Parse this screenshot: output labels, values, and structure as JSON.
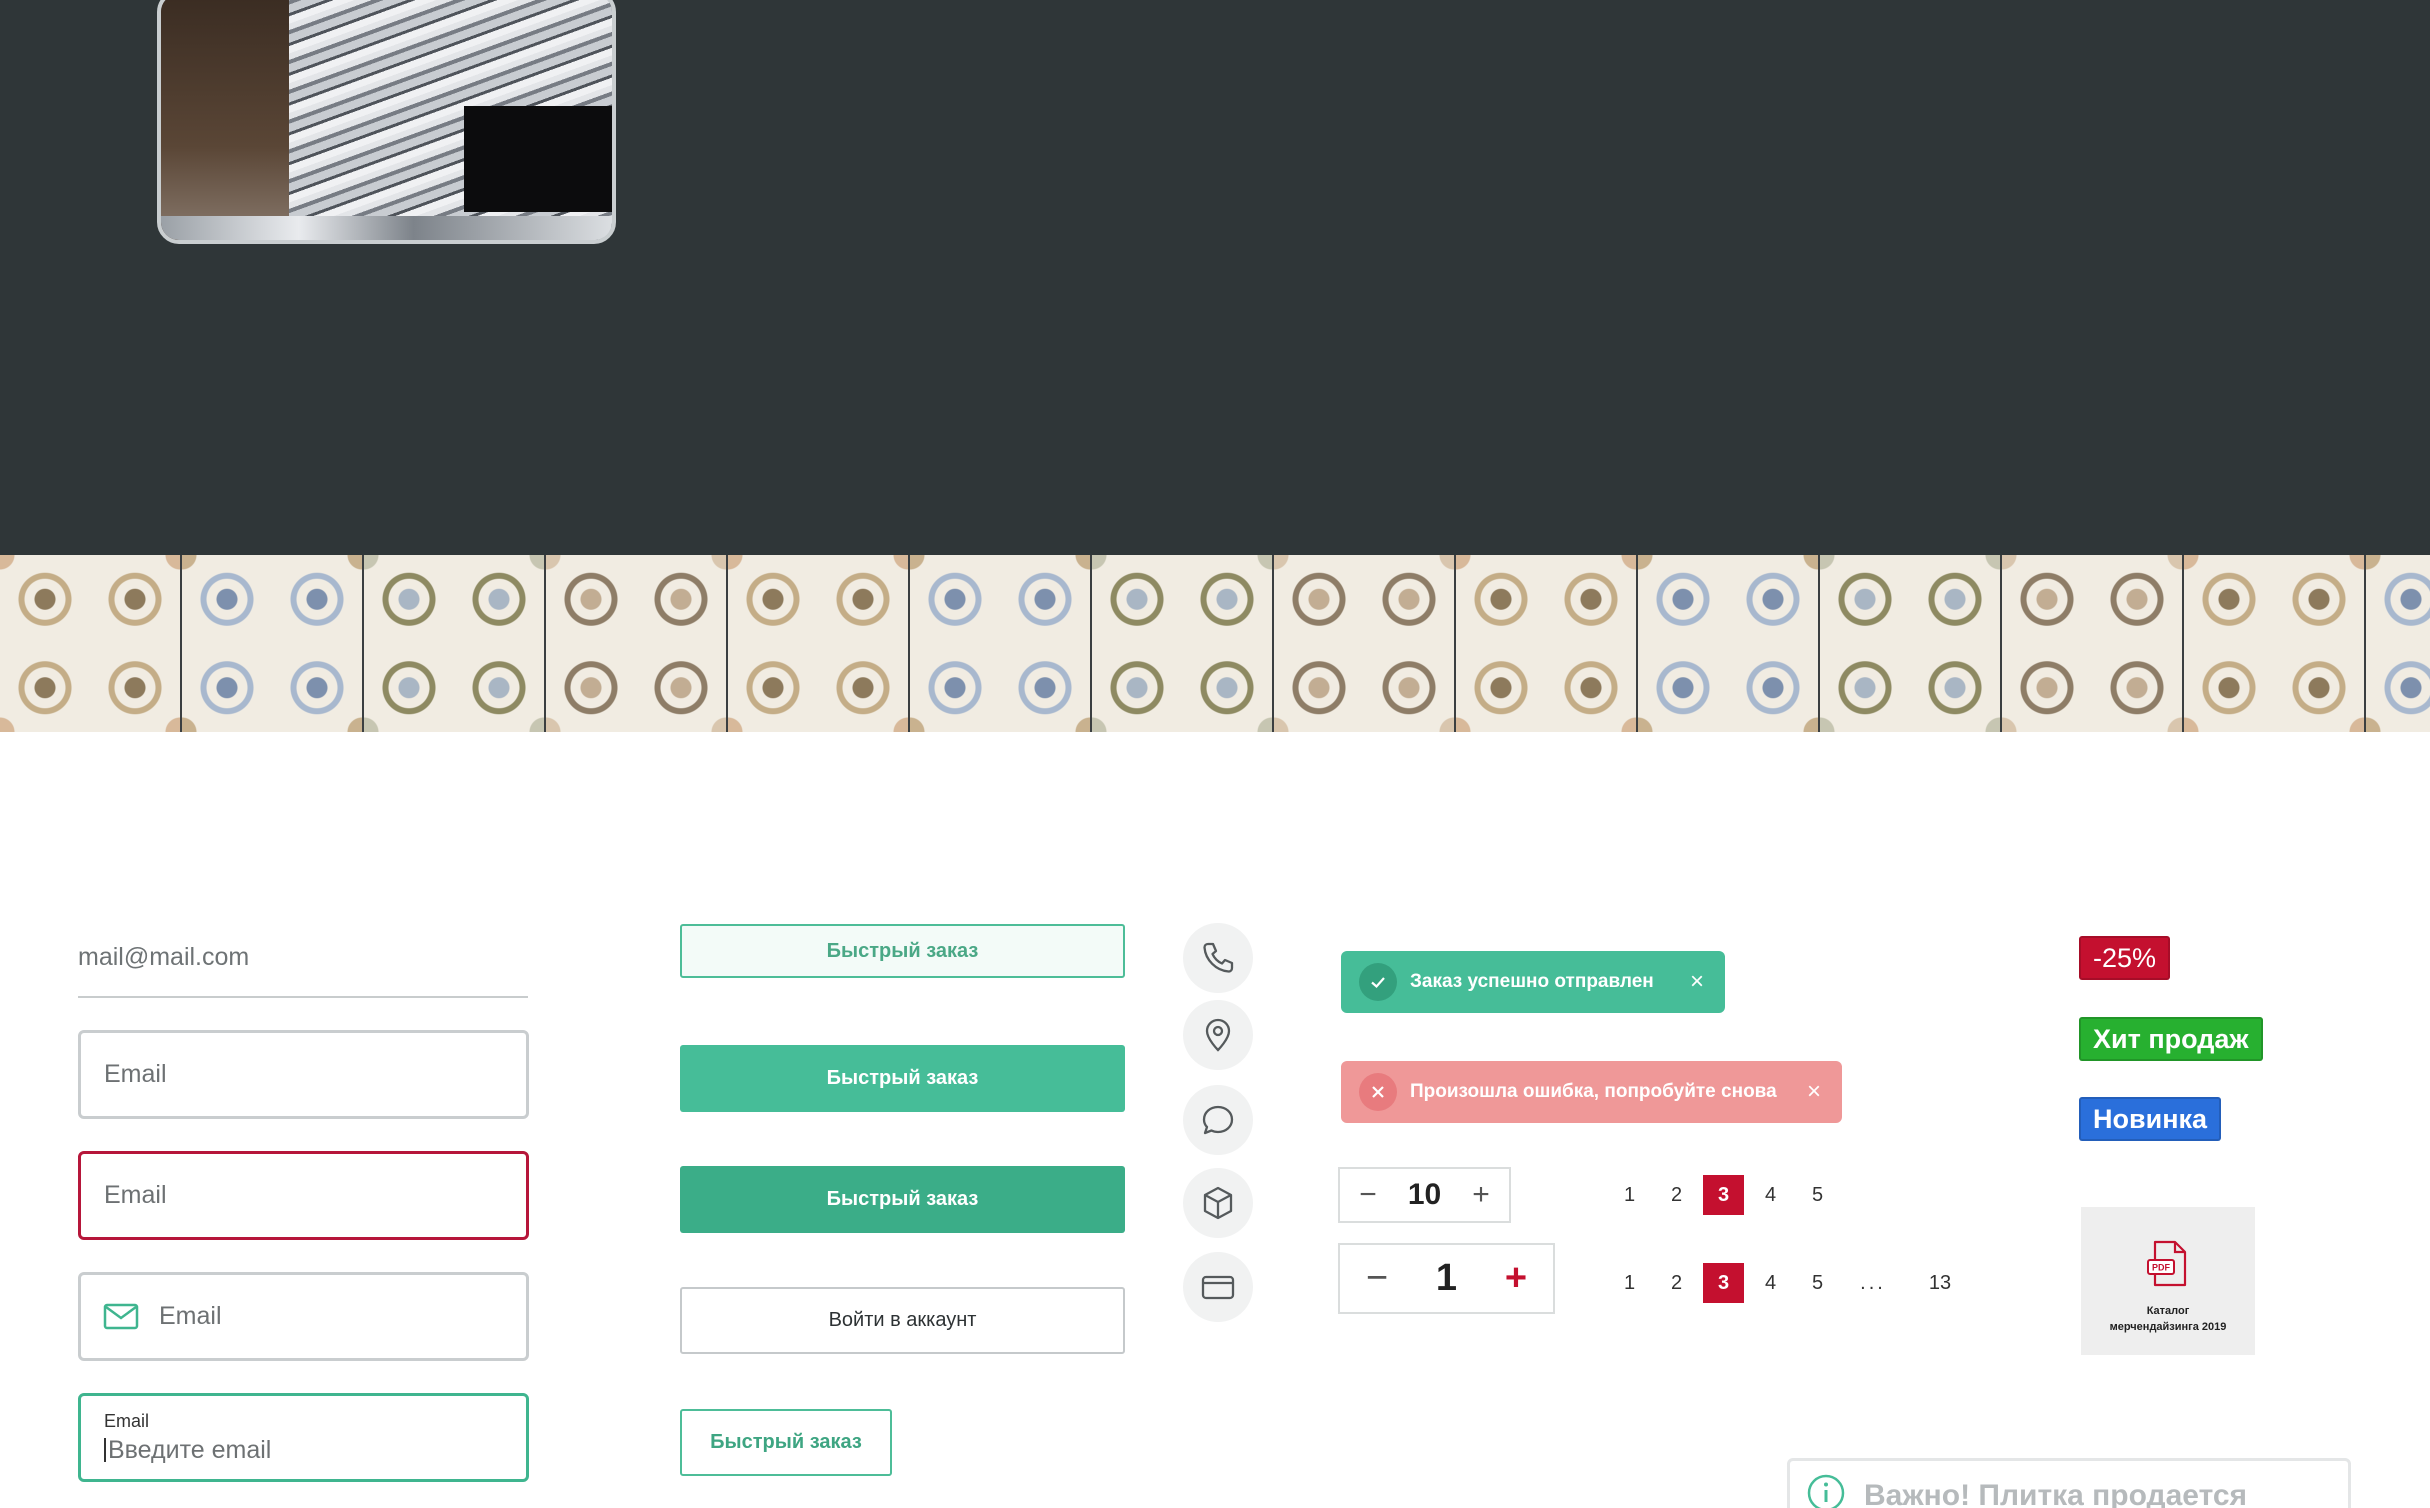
{
  "inputs": {
    "underline_value": "mail@mail.com",
    "default_placeholder": "Email",
    "error_placeholder": "Email",
    "icon_placeholder": "Email",
    "active_label": "Email",
    "active_placeholder": "Введите email"
  },
  "buttons": {
    "quick_order_outline": "Быстрый заказ",
    "quick_order_filled": "Быстрый заказ",
    "quick_order_filled_hover": "Быстрый заказ",
    "login": "Войти в аккаунт",
    "quick_order_small": "Быстрый заказ"
  },
  "round_icons": [
    "phone-icon",
    "location-pin-icon",
    "chat-bubble-icon",
    "box-icon",
    "credit-card-icon"
  ],
  "toasts": {
    "success": "Заказ успешно отправлен",
    "error": "Произошла ошибка, попробуйте снова",
    "close_glyph": "×"
  },
  "steppers": [
    {
      "minus": "−",
      "value": "10",
      "plus": "+"
    },
    {
      "minus": "−",
      "value": "1",
      "plus": "+"
    }
  ],
  "pagination": {
    "short": [
      "1",
      "2",
      "3",
      "4",
      "5"
    ],
    "long": [
      "1",
      "2",
      "3",
      "4",
      "5",
      "...",
      "13"
    ],
    "current": "3"
  },
  "badges": {
    "sale": "-25%",
    "hit": "Хит продаж",
    "new": "Новинка"
  },
  "catalog": {
    "line1": "Каталог",
    "line2": "мерчендайзинга 2019",
    "icon_text": "PDF"
  },
  "notice": {
    "text": "Важно! Плитка продается"
  },
  "colors": {
    "dark_band": "#2f3638",
    "accent_green": "#46bd98",
    "error_red": "#c4102f",
    "toast_error": "#ef9898",
    "badge_green": "#27b030",
    "badge_blue": "#2a6fdb"
  }
}
